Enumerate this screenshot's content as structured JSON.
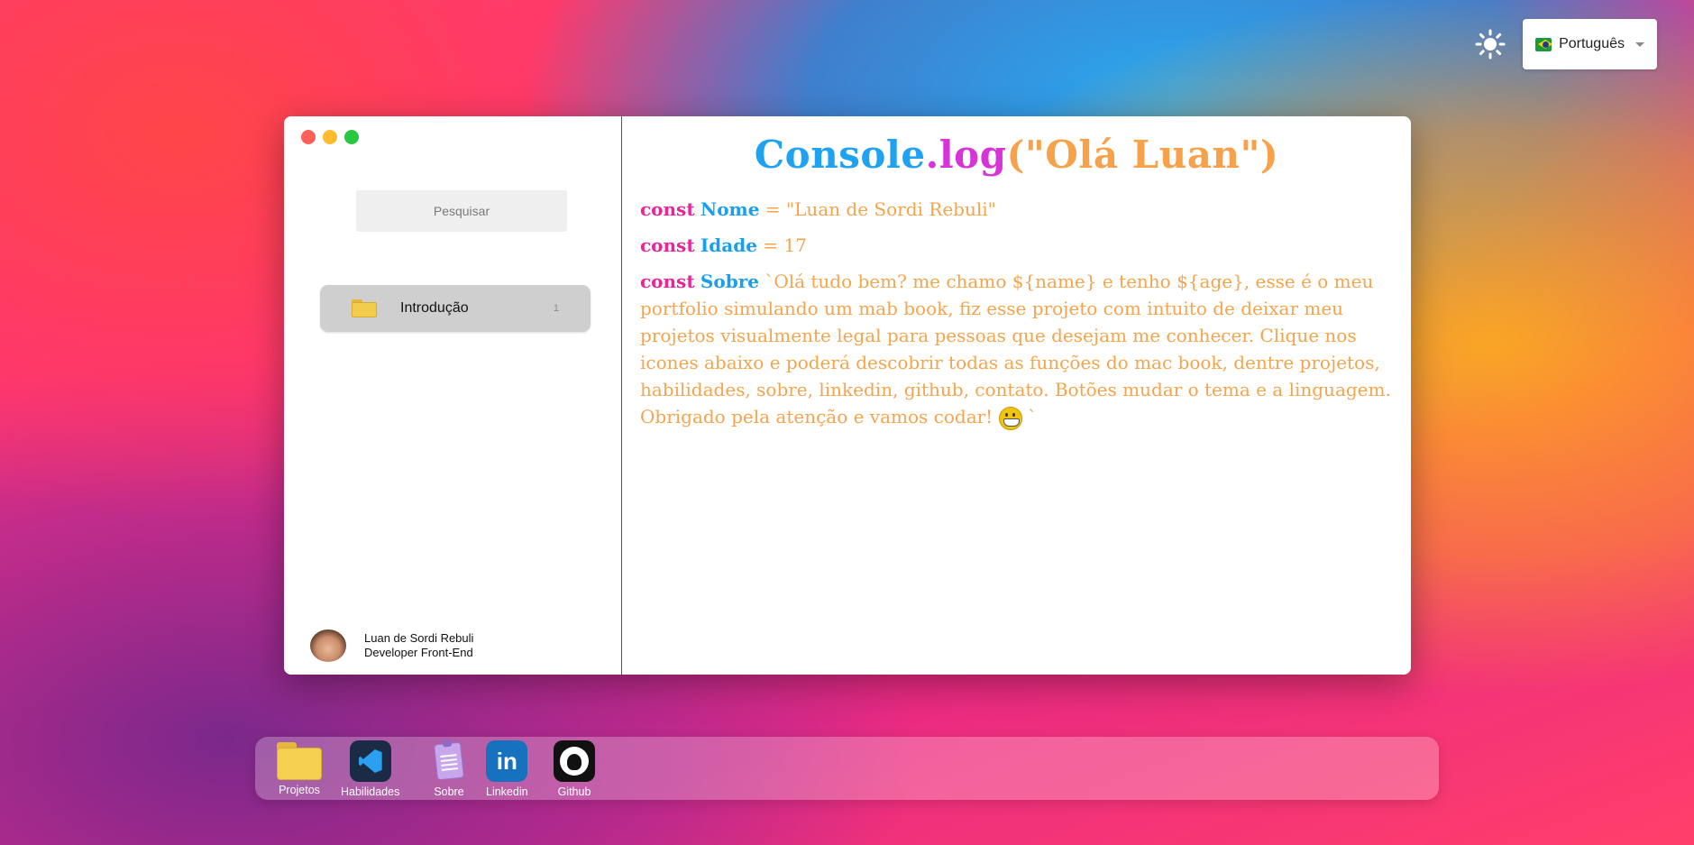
{
  "language": {
    "label": "Português",
    "flag": "brazil-flag-icon"
  },
  "theme_toggle": {
    "icon": "sun-icon"
  },
  "window": {
    "search": {
      "placeholder": "Pesquisar"
    },
    "folders": [
      {
        "label": "Introdução",
        "count": "1"
      }
    ],
    "profile": {
      "name": "Luan de Sordi Rebuli",
      "role": "Developer Front-End"
    },
    "title": {
      "part1": "Console",
      "dot": ".",
      "part2": "log",
      "part3": "(\"Olá Luan\")"
    },
    "code": {
      "keyword": "const",
      "nome_id": "Nome",
      "nome_val": "= \"Luan de Sordi Rebuli\"",
      "idade_id": "Idade",
      "idade_val": "= 17",
      "sobre_id": "Sobre",
      "sobre_val": " `Olá tudo bem? me chamo ${name} e tenho ${age}, esse é o meu portfolio simulando um mab book, fiz esse projeto com intuito de deixar meu projetos visualmente legal para pessoas que desejam me conhecer. Clique nos icones abaixo e poderá descobrir todas as funções do mac book, dentre projetos, habilidades, sobre, linkedin, github, contato. Botões mudar o tema e a linguagem. Obrigado pela atenção e vamos codar!",
      "sobre_end": " `"
    }
  },
  "dock": {
    "items": [
      {
        "label": "Projetos",
        "icon": "folder-icon"
      },
      {
        "label": "Habilidades",
        "icon": "vscode-icon"
      },
      {
        "label": "Sobre",
        "icon": "clipboard-icon"
      },
      {
        "label": "Linkedin",
        "icon": "linkedin-icon"
      },
      {
        "label": "Github",
        "icon": "github-icon"
      }
    ]
  },
  "colors": {
    "close": "#fe5f57",
    "minimize": "#febb2e",
    "maximize": "#28c840",
    "keyword": "#f2229a",
    "identifier": "#1a9ef0",
    "string": "#f5a44c",
    "title_magenta": "#d633d9"
  }
}
